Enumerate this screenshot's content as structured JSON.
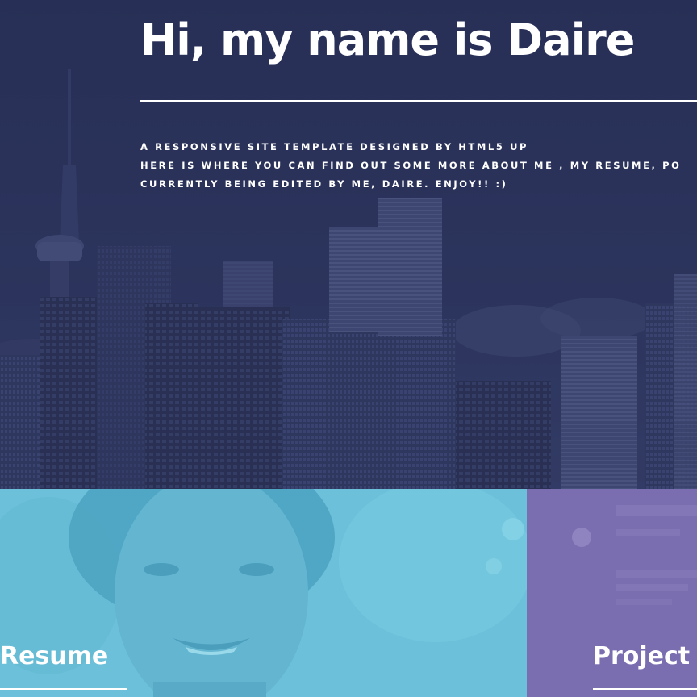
{
  "banner": {
    "title": "Hi, my name is Daire",
    "lines": [
      "A RESPONSIVE SITE TEMPLATE DESIGNED BY HTML5 UP",
      "HERE IS WHERE YOU CAN FIND OUT SOME MORE ABOUT ME , MY RESUME, PO",
      "CURRENTLY BEING EDITED BY ME, DAIRE. ENJOY!! :)"
    ]
  },
  "tiles": [
    {
      "title": "Resume",
      "color": "#6fc3dc"
    },
    {
      "title": "Project F",
      "color": "#7c6fb1"
    }
  ],
  "colors": {
    "banner_overlay": "#2c3558",
    "text": "#ffffff"
  }
}
